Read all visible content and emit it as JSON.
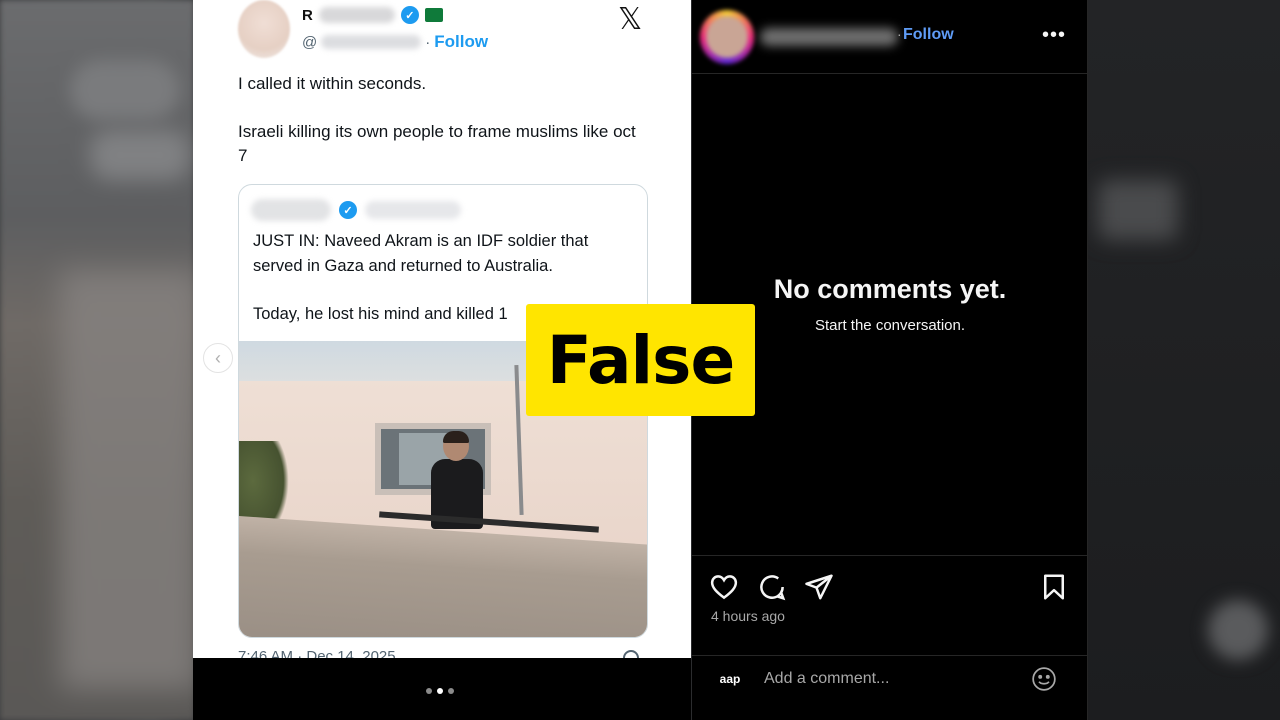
{
  "tweet": {
    "name_initial": "R",
    "handle_prefix": "@",
    "follow_label": "Follow",
    "x_logo": "𝕏",
    "text_lines": [
      "I called it within seconds.",
      "Israeli killing its own people to frame muslims like oct 7"
    ],
    "quote": {
      "paragraph1": "JUST IN: Naveed Akram is an IDF soldier that served in Gaza and returned to Australia.",
      "paragraph2": "Today, he lost his mind and killed 1"
    },
    "timestamp": "7:46 AM · Dec 14, 2025"
  },
  "carousel": {
    "prev_glyph": "‹",
    "dots": 3,
    "active_dot": 2
  },
  "comments_panel": {
    "follow_label": "Follow",
    "separator": "·",
    "more_label": "•••",
    "empty_title": "No comments yet.",
    "empty_subtitle": "Start the conversation.",
    "posted_time": "4 hours ago",
    "commenter_badge": "aap",
    "add_comment_placeholder": "Add a comment..."
  },
  "overlay": {
    "verdict": "False",
    "verdict_color": "#ffe500"
  },
  "icons": {
    "like": "heart-icon",
    "comment": "comment-bubble-icon",
    "share": "paper-plane-icon",
    "save": "bookmark-icon",
    "emoji": "smiley-icon"
  },
  "colors": {
    "x_blue": "#1d9bf0",
    "ig_follow_blue": "#5f9cf6",
    "ig_background": "#000000"
  }
}
